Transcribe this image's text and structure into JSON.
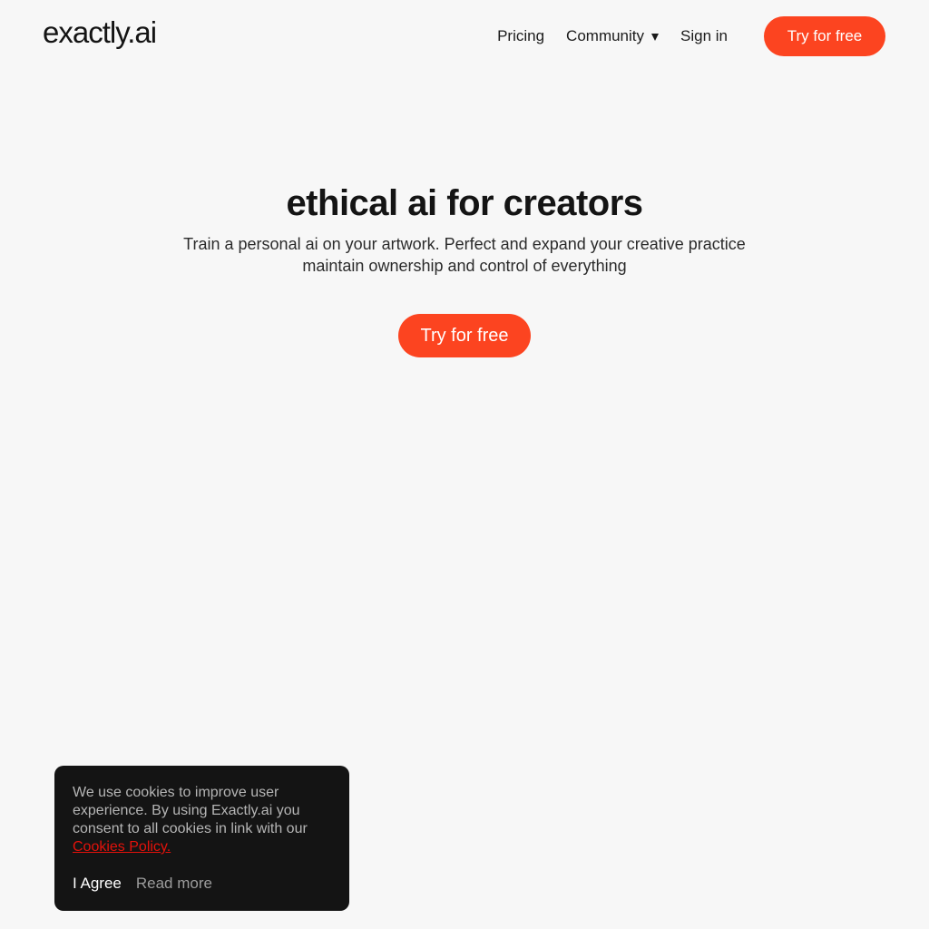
{
  "header": {
    "logo_text": "exactly.ai",
    "nav": {
      "pricing": "Pricing",
      "community": "Community",
      "community_icon": "caret-down-icon",
      "sign_in": "Sign in",
      "cta": "Try for free"
    }
  },
  "hero": {
    "title": "ethical ai for creators",
    "subtitle_line1": "Train a personal ai on your artwork. Perfect and expand your creative practice",
    "subtitle_line2": "maintain ownership and control of everything",
    "cta": "Try for free"
  },
  "cookie_banner": {
    "message": "We use cookies to improve user experience. By using Exactly.ai you consent to all cookies in link with our",
    "policy_link": "Cookies Policy.",
    "agree": "I Agree",
    "read_more": "Read more"
  },
  "colors": {
    "background": "#f7f7f7",
    "accent": "#fc4420",
    "banner_bg": "#141414",
    "policy_link": "#e3120b"
  }
}
